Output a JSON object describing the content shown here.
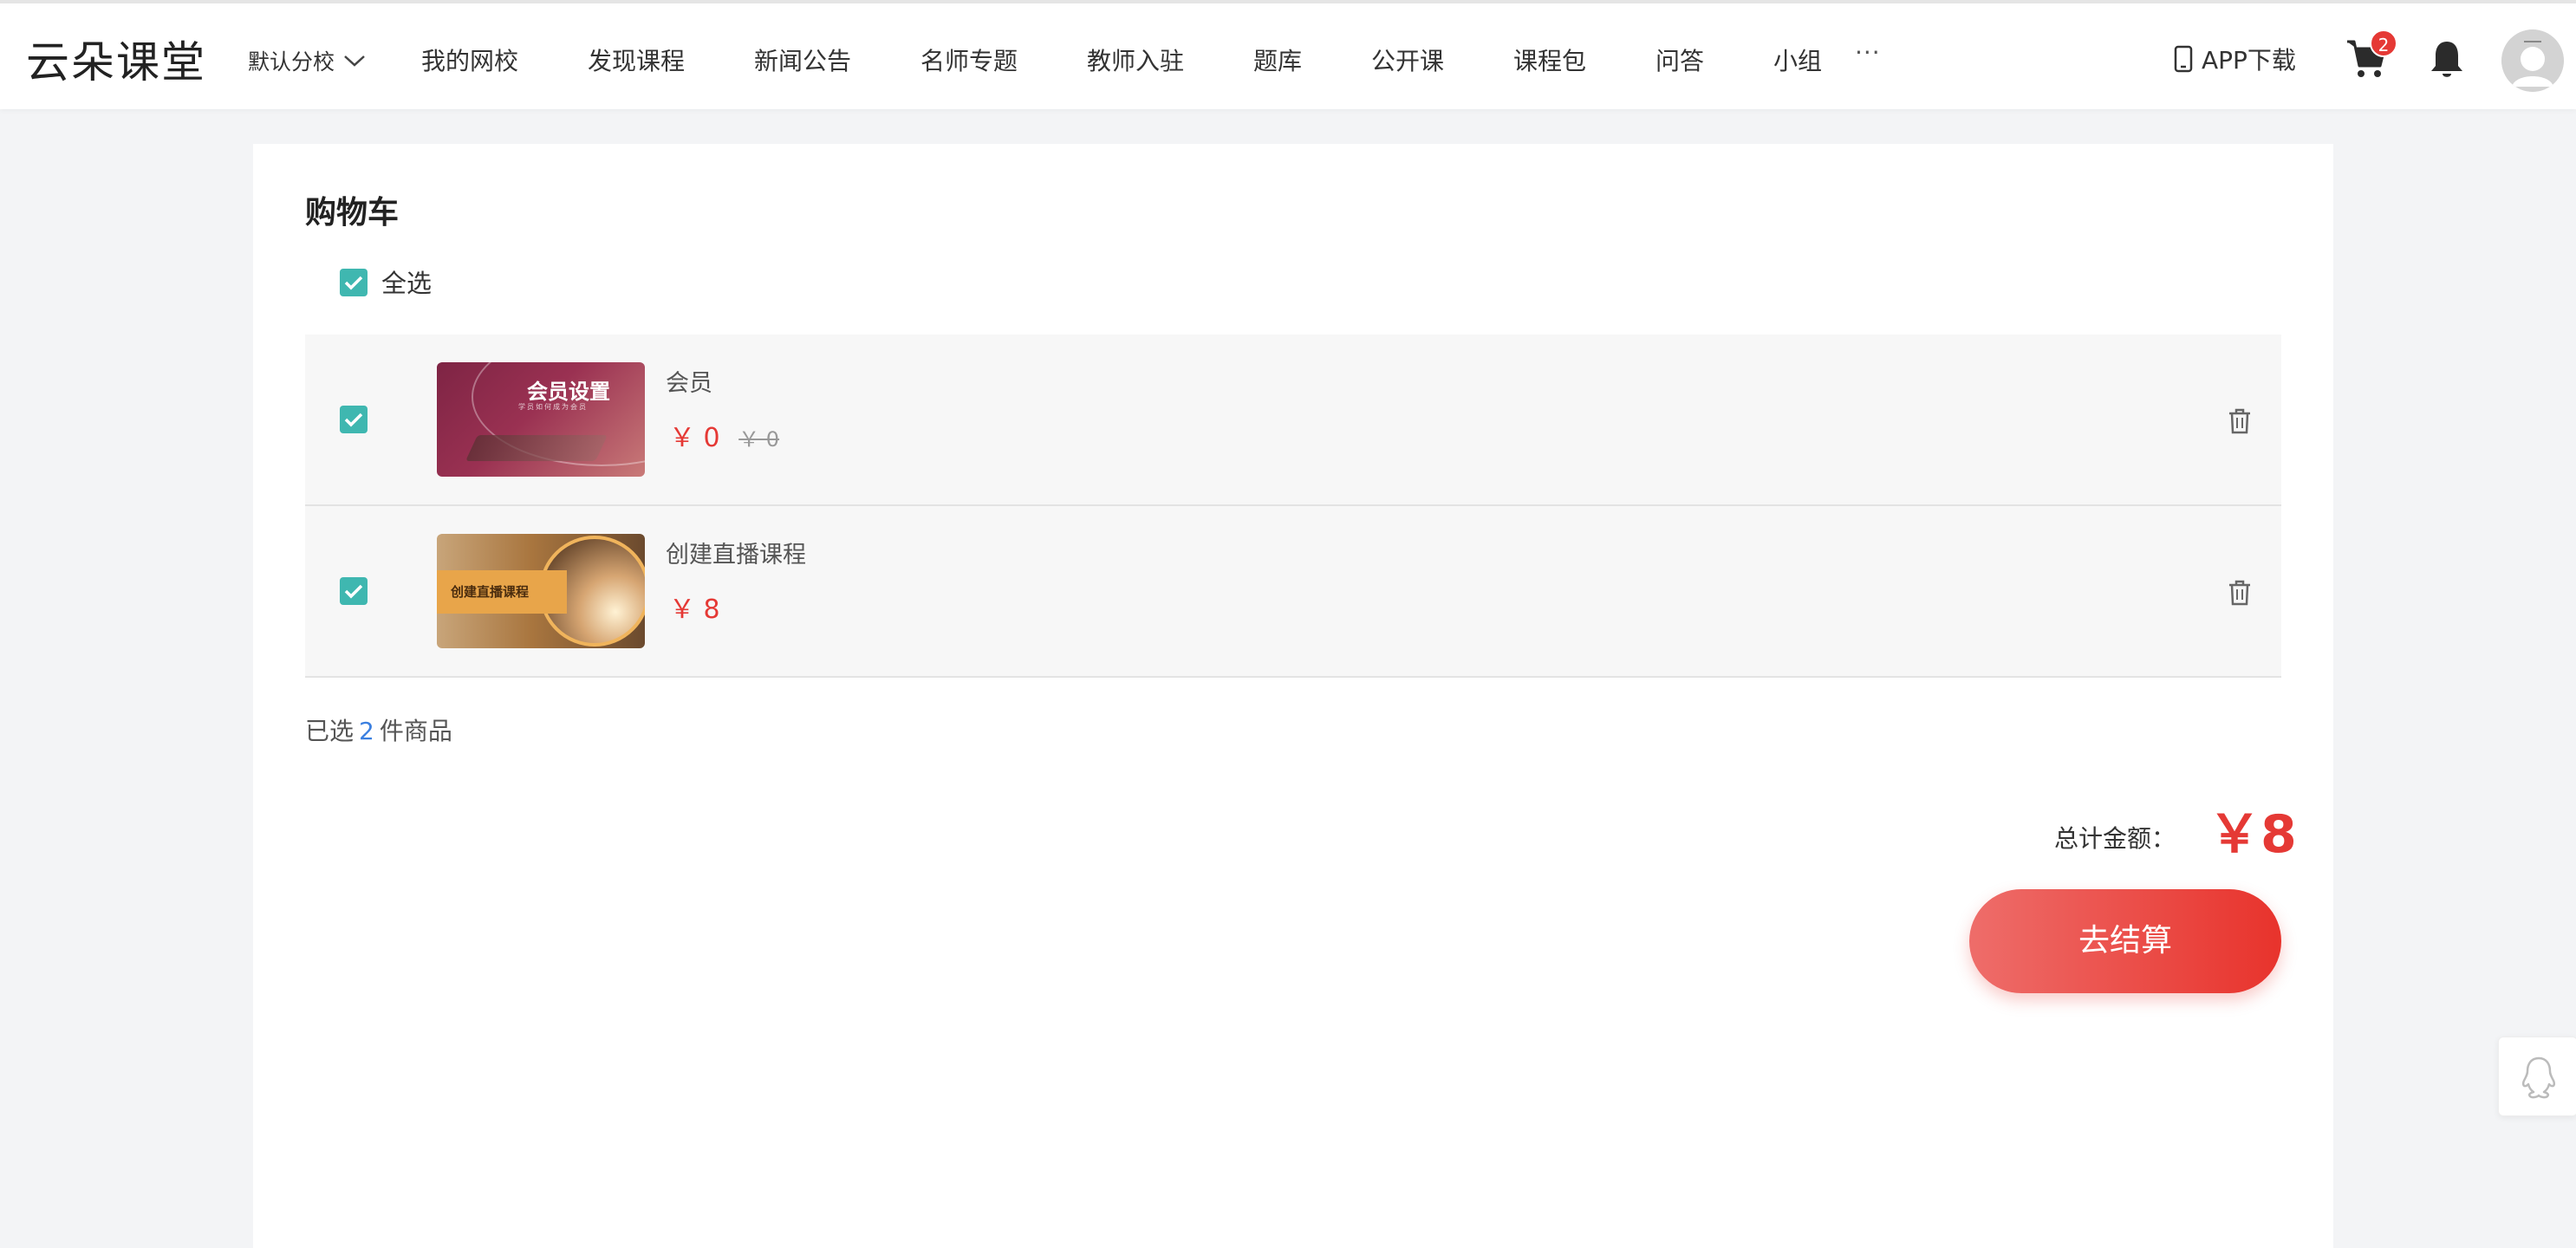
{
  "header": {
    "logo": "云朵课堂",
    "branch": "默认分校",
    "nav": [
      {
        "label": "我的网校"
      },
      {
        "label": "发现课程"
      },
      {
        "label": "新闻公告"
      },
      {
        "label": "名师专题"
      },
      {
        "label": "教师入驻"
      },
      {
        "label": "题库"
      },
      {
        "label": "公开课"
      },
      {
        "label": "课程包"
      },
      {
        "label": "问答"
      },
      {
        "label": "小组"
      }
    ],
    "more": "···",
    "app_download": "APP下载",
    "cart_count": "2",
    "icons": [
      "chevron-down-icon",
      "phone-icon",
      "cart-icon",
      "bell-icon",
      "avatar",
      "trash-icon",
      "qq-icon",
      "checkmark-icon"
    ]
  },
  "cart": {
    "title": "购物车",
    "select_all": "全选",
    "items": [
      {
        "thumb_title": "会员设置",
        "thumb_subtitle": "学员如何成为会员",
        "name": "会员",
        "price": "￥ 0",
        "original_price": "￥ 0",
        "checked": true
      },
      {
        "thumb_title": "创建直播课程",
        "name": "创建直播课程",
        "price": "￥ 8",
        "checked": true
      }
    ],
    "selected_prefix": "已选",
    "selected_count": "2",
    "selected_suffix": "件商品",
    "total_label": "总计金额：",
    "total_value": "￥8",
    "checkout_label": "去结算"
  },
  "colors": {
    "accent_red": "#e53935",
    "checkbox_teal": "#3fb7b0",
    "count_blue": "#3a7fe0"
  }
}
